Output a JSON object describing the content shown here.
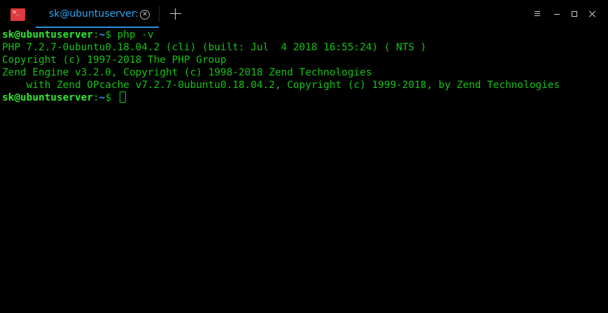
{
  "app": {
    "icon": "terminal-app-icon",
    "icon_glyph": ">_",
    "accent": "#e0393e"
  },
  "tabs": [
    {
      "label": "sk@ubuntuserver: ~",
      "active": true,
      "close_icon": "close-circle-icon"
    }
  ],
  "new_tab": {
    "icon": "plus-icon"
  },
  "window_controls": {
    "menu_icon": "hamburger-menu-icon",
    "minimize_icon": "minimize-icon",
    "maximize_icon": "maximize-icon",
    "close_icon": "close-icon"
  },
  "terminal": {
    "prompt_user": "sk@ubuntuserver",
    "prompt_path": "~",
    "prompt_symbol": "$ ",
    "command": "php -v",
    "output": [
      "PHP 7.2.7-0ubuntu0.18.04.2 (cli) (built: Jul  4 2018 16:55:24) ( NTS )",
      "Copyright (c) 1997-2018 The PHP Group",
      "Zend Engine v3.2.0, Copyright (c) 1998-2018 Zend Technologies",
      "    with Zend OPcache v7.2.7-0ubuntu0.18.04.2, Copyright (c) 1999-2018, by Zend Technologies"
    ],
    "colors": {
      "text": "#14c414",
      "user": "#2ee82e",
      "path": "#3aa0ff",
      "background": "#000000"
    }
  }
}
